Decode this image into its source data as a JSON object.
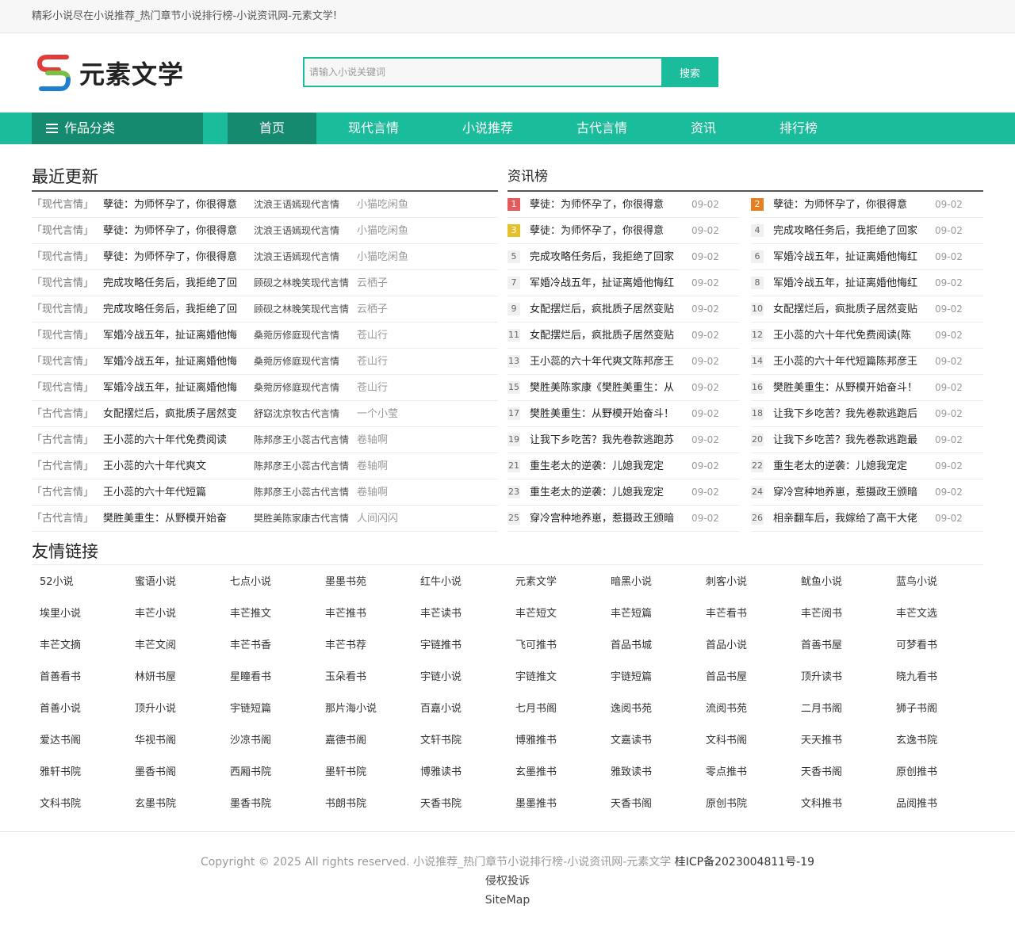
{
  "topbar": {
    "text": "精彩小说尽在小说推荐_热门章节小说排行榜-小说资讯网-元素文学!"
  },
  "logo": {
    "text": "元素文学"
  },
  "search": {
    "placeholder": "请输入小说关键词",
    "button": "搜索"
  },
  "nav": {
    "category": "作品分类",
    "items": [
      {
        "label": "首页",
        "active": true
      },
      {
        "label": "现代言情"
      },
      {
        "label": "小说推荐"
      },
      {
        "label": "古代言情"
      },
      {
        "label": "资讯"
      },
      {
        "label": "排行榜"
      }
    ]
  },
  "recent": {
    "title": "最近更新",
    "rows": [
      {
        "cat": "「现代言情」",
        "title": "孽徒：为师怀孕了，你很得意",
        "author": "沈浪王语嫣现代言情",
        "site": "小猫吃闲鱼"
      },
      {
        "cat": "「现代言情」",
        "title": "孽徒：为师怀孕了，你很得意",
        "author": "沈浪王语嫣现代言情",
        "site": "小猫吃闲鱼"
      },
      {
        "cat": "「现代言情」",
        "title": "孽徒：为师怀孕了，你很得意",
        "author": "沈浪王语嫣现代言情",
        "site": "小猫吃闲鱼"
      },
      {
        "cat": "「现代言情」",
        "title": "完成攻略任务后，我拒绝了回",
        "author": "顾砚之林晚笑现代言情",
        "site": "云栖子"
      },
      {
        "cat": "「现代言情」",
        "title": "完成攻略任务后，我拒绝了回",
        "author": "顾砚之林晚笑现代言情",
        "site": "云栖子"
      },
      {
        "cat": "「现代言情」",
        "title": "军婚冷战五年，扯证离婚他悔",
        "author": "桑菀厉修庭现代言情",
        "site": "苍山行"
      },
      {
        "cat": "「现代言情」",
        "title": "军婚冷战五年，扯证离婚他悔",
        "author": "桑菀厉修庭现代言情",
        "site": "苍山行"
      },
      {
        "cat": "「现代言情」",
        "title": "军婚冷战五年，扯证离婚他悔",
        "author": "桑菀厉修庭现代言情",
        "site": "苍山行"
      },
      {
        "cat": "「古代言情」",
        "title": "女配摆烂后，疯批质子居然变",
        "author": "舒窈沈京牧古代言情",
        "site": "一个小莹"
      },
      {
        "cat": "「古代言情」",
        "title": "王小蕊的六十年代免费阅读",
        "author": "陈邦彦王小蕊古代言情",
        "site": "卷轴啊"
      },
      {
        "cat": "「古代言情」",
        "title": "王小蕊的六十年代爽文",
        "author": "陈邦彦王小蕊古代言情",
        "site": "卷轴啊"
      },
      {
        "cat": "「古代言情」",
        "title": "王小蕊的六十年代短篇",
        "author": "陈邦彦王小蕊古代言情",
        "site": "卷轴啊"
      },
      {
        "cat": "「古代言情」",
        "title": "樊胜美重生：从野模开始奋",
        "author": "樊胜美陈家康古代言情",
        "site": "人间闪闪"
      }
    ]
  },
  "ranking": {
    "title": "资讯榜",
    "left": [
      {
        "num": "1",
        "title": "孽徒：为师怀孕了，你很得意",
        "date": "09-02"
      },
      {
        "num": "3",
        "title": "孽徒：为师怀孕了，你很得意",
        "date": "09-02"
      },
      {
        "num": "5",
        "title": "完成攻略任务后，我拒绝了回家",
        "date": "09-02"
      },
      {
        "num": "7",
        "title": "军婚冷战五年，扯证离婚他悔红",
        "date": "09-02"
      },
      {
        "num": "9",
        "title": "女配摆烂后，疯批质子居然变贴",
        "date": "09-02"
      },
      {
        "num": "11",
        "title": "女配摆烂后，疯批质子居然变贴",
        "date": "09-02"
      },
      {
        "num": "13",
        "title": "王小蕊的六十年代爽文陈邦彦王",
        "date": "09-02"
      },
      {
        "num": "15",
        "title": "樊胜美陈家康《樊胜美重生：从",
        "date": "09-02"
      },
      {
        "num": "17",
        "title": "樊胜美重生：从野模开始奋斗！",
        "date": "09-02"
      },
      {
        "num": "19",
        "title": "让我下乡吃苦？我先卷款逃跑苏",
        "date": "09-02"
      },
      {
        "num": "21",
        "title": "重生老太的逆袭：儿媳我宠定",
        "date": "09-02"
      },
      {
        "num": "23",
        "title": "重生老太的逆袭：儿媳我宠定",
        "date": "09-02"
      },
      {
        "num": "25",
        "title": "穿冷宫种地养崽，惹摄政王颁暗",
        "date": "09-02"
      }
    ],
    "right": [
      {
        "num": "2",
        "title": "孽徒：为师怀孕了，你很得意",
        "date": "09-02"
      },
      {
        "num": "4",
        "title": "完成攻略任务后，我拒绝了回家",
        "date": "09-02"
      },
      {
        "num": "6",
        "title": "军婚冷战五年，扯证离婚他悔红",
        "date": "09-02"
      },
      {
        "num": "8",
        "title": "军婚冷战五年，扯证离婚他悔红",
        "date": "09-02"
      },
      {
        "num": "10",
        "title": "女配摆烂后，疯批质子居然变贴",
        "date": "09-02"
      },
      {
        "num": "12",
        "title": "王小蕊的六十年代免费阅读(陈",
        "date": "09-02"
      },
      {
        "num": "14",
        "title": "王小蕊的六十年代短篇陈邦彦王",
        "date": "09-02"
      },
      {
        "num": "16",
        "title": "樊胜美重生：从野模开始奋斗！",
        "date": "09-02"
      },
      {
        "num": "18",
        "title": "让我下乡吃苦？我先卷款逃跑后",
        "date": "09-02"
      },
      {
        "num": "20",
        "title": "让我下乡吃苦？我先卷款逃跑最",
        "date": "09-02"
      },
      {
        "num": "22",
        "title": "重生老太的逆袭：儿媳我宠定",
        "date": "09-02"
      },
      {
        "num": "24",
        "title": "穿冷宫种地养崽，惹摄政王颁暗",
        "date": "09-02"
      },
      {
        "num": "26",
        "title": "相亲翻车后，我嫁给了高干大佬",
        "date": "09-02"
      }
    ]
  },
  "links": {
    "title": "友情链接",
    "items": [
      "52小说",
      "蜜语小说",
      "七点小说",
      "墨墨书苑",
      "红牛小说",
      "元素文学",
      "暗黑小说",
      "刺客小说",
      "鱿鱼小说",
      "蓝鸟小说",
      "埃里小说",
      "丰芒小说",
      "丰芒推文",
      "丰芒推书",
      "丰芒读书",
      "丰芒短文",
      "丰芒短篇",
      "丰芒看书",
      "丰芒阅书",
      "丰芒文选",
      "丰芒文摘",
      "丰芒文阅",
      "丰芒书香",
      "丰芒书荐",
      "宇链推书",
      "飞可推书",
      "首品书城",
      "首品小说",
      "首善书屋",
      "可梦看书",
      "首善看书",
      "林妍书屋",
      "星瞳看书",
      "玉朵看书",
      "宇链小说",
      "宇链推文",
      "宇链短篇",
      "首品书屋",
      "顶升读书",
      "晓九看书",
      "首善小说",
      "顶升小说",
      "宇链短篇",
      "那片海小说",
      "百嘉小说",
      "七月书阁",
      "逸阅书苑",
      "流阅书苑",
      "二月书阁",
      "狮子书阁",
      "爱达书阁",
      "华视书阁",
      "沙凉书阁",
      "嘉德书阁",
      "文轩书院",
      "博雅推书",
      "文嘉读书",
      "文科书阁",
      "天天推书",
      "玄逸书院",
      "雅轩书院",
      "墨香书阁",
      "西厢书院",
      "墨轩书院",
      "博雅读书",
      "玄墨推书",
      "雅致读书",
      "零点推书",
      "天香书阁",
      "原创推书",
      "文科书院",
      "玄墨书院",
      "墨香书院",
      "书朗书院",
      "天香书院",
      "墨墨推书",
      "天香书阁",
      "原创书院",
      "文科推书",
      "品阅推书"
    ]
  },
  "footer": {
    "copyright": "Copyright © 2025 All rights reserved. 小说推荐_热门章节小说排行榜-小说资讯网-元素文学",
    "icp": "桂ICP备2023004811号-19",
    "report": "侵权投诉",
    "sitemap": "SiteMap"
  },
  "colors": {
    "accent": "#1bbc9b",
    "accent_dark": "#168a6f"
  }
}
